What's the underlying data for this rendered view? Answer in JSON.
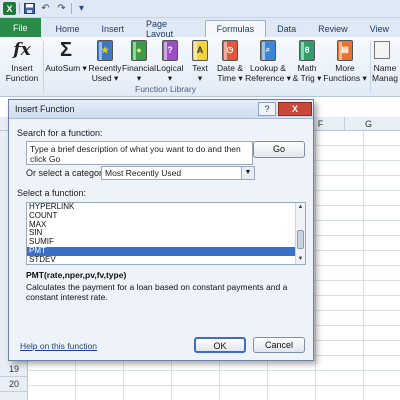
{
  "qat": {
    "logo": "X",
    "undo": "↶",
    "redo": "↷"
  },
  "tabs": [
    "File",
    "Home",
    "Insert",
    "Page Layout",
    "Formulas",
    "Data",
    "Review",
    "View"
  ],
  "ribbon": {
    "insert_function": "Insert\nFunction",
    "fx": "fx",
    "autosum": "AutoSum ▾",
    "recently_used": "Recently\nUsed ▾",
    "financial": "Financial\n▾",
    "logical": "Logical\n▾",
    "text": "Text\n▾",
    "date_time": "Date &\nTime ▾",
    "lookup": "Lookup &\nReference ▾",
    "math": "Math\n& Trig ▾",
    "more": "More\nFunctions ▾",
    "name_manager": "Name\nManag",
    "group_label": "Function Library",
    "book_glyphs": {
      "logical": "?",
      "text": "A",
      "math": "θ"
    }
  },
  "sheet": {
    "columns": [
      "F",
      "G"
    ],
    "rows": [
      "19",
      "20"
    ]
  },
  "dialog": {
    "title": "Insert Function",
    "help_glyph": "?",
    "close_glyph": "X",
    "search_label": "Search for a function:",
    "search_value": "Type a brief description of what you want to do and then click Go",
    "go_label": "Go",
    "category_label": "Or select a category:",
    "category_value": "Most Recently Used",
    "select_label": "Select a function:",
    "functions": [
      "HYPERLINK",
      "COUNT",
      "MAX",
      "SIN",
      "SUMIF",
      "PMT",
      "STDEV"
    ],
    "selected_index": 5,
    "signature": "PMT(rate,nper,pv,fv,type)",
    "description": "Calculates the payment for a loan based on constant payments and a constant interest rate.",
    "help_link": "Help on this function",
    "ok_label": "OK",
    "cancel_label": "Cancel"
  },
  "colors": {
    "file_tab": "#2a8a47",
    "selection": "#3a6fc6",
    "link": "#1c3fa0"
  }
}
